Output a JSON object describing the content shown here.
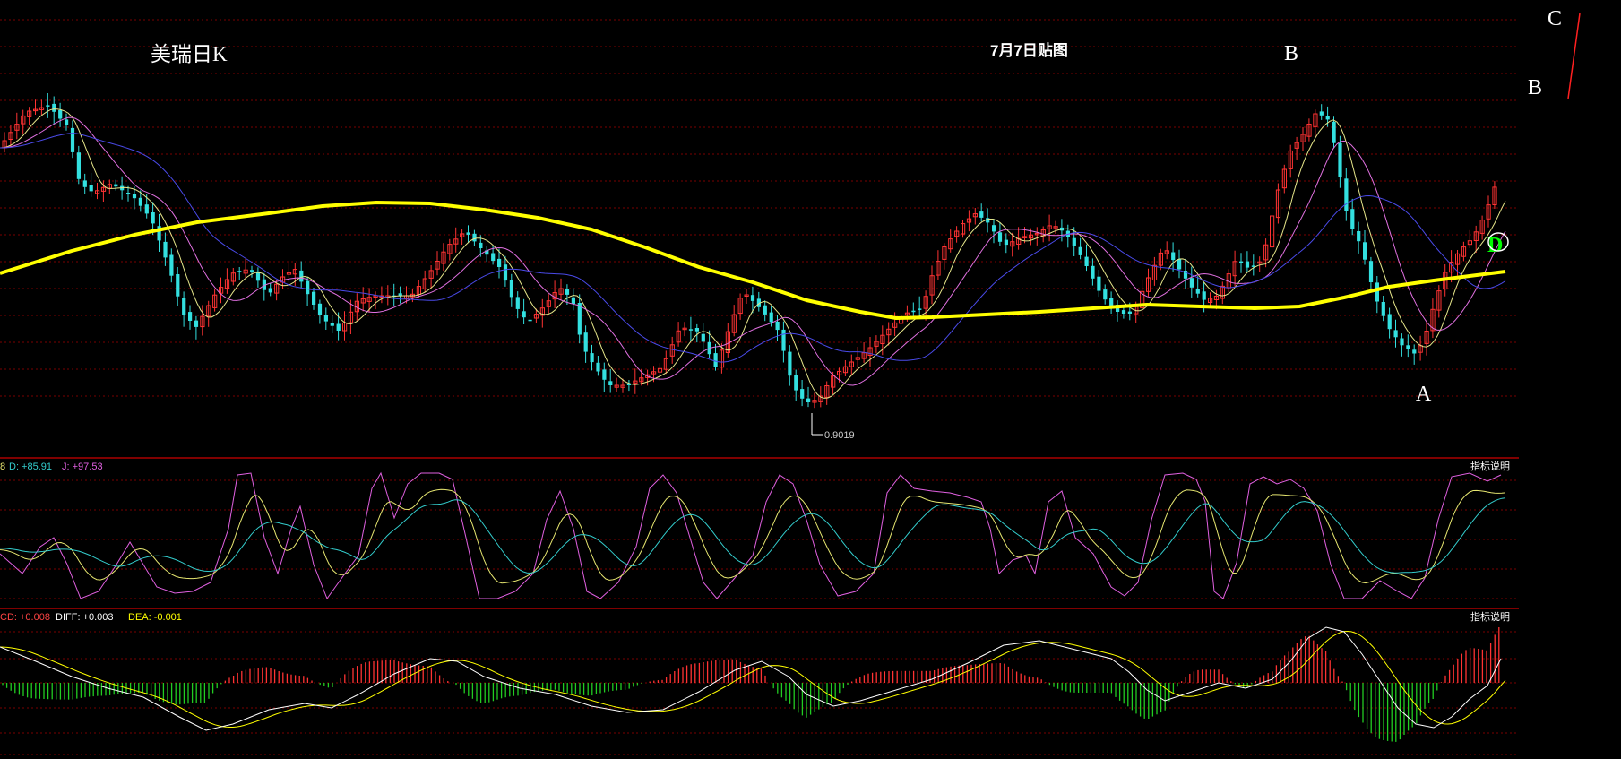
{
  "chart_data": {
    "type": "candlestick",
    "title": "美瑞日K",
    "subtitle": "7月7日贴图",
    "wave_labels": {
      "a": "A",
      "b_top": "B",
      "b_right": "B",
      "c": "C",
      "d": "D"
    },
    "low_marker": "0.9019",
    "kdj": {
      "label_d": "D: +85.91",
      "label_j": "J: +97.53",
      "label_prefix": "8",
      "desc": "指标说明"
    },
    "macd": {
      "label_macd": "CD: +0.008",
      "label_diff": "DIFF: +0.003",
      "label_dea": "DEA: -0.001",
      "desc": "指标说明"
    },
    "colors": {
      "up": "#ff3333",
      "down": "#33e0e0",
      "ma_long": "#ffff00",
      "ma_short": "#e6e68a",
      "ma_mid": "#e070e0",
      "ma_60": "#4a4ae8",
      "kdj_k": "#e6e670",
      "kdj_d": "#33cccc",
      "kdj_j": "#e060e0",
      "diff": "#ffffff",
      "dea": "#ffff00",
      "hist_up": "#ff3333",
      "hist_down": "#22cc22",
      "grid": "#7a0000",
      "label_white": "#ffffff",
      "label_green": "#00ff00"
    }
  }
}
